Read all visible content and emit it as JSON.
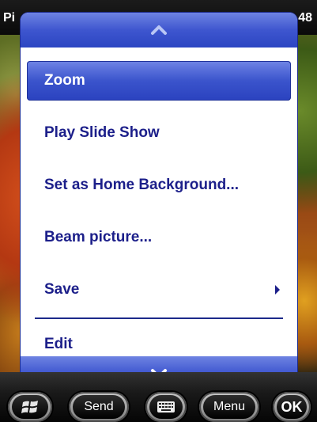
{
  "statusbar": {
    "title": "Pi",
    "clock": "48"
  },
  "menu": {
    "items": [
      {
        "label": "Zoom",
        "selected": true
      },
      {
        "label": "Play Slide Show"
      },
      {
        "label": "Set as Home Background..."
      },
      {
        "label": "Beam picture..."
      },
      {
        "label": "Save",
        "submenu": true
      },
      {
        "label": "Edit"
      }
    ],
    "scroll_up_icon": "chevron-up-icon",
    "scroll_down_icon": "chevron-down-icon"
  },
  "softkeys": {
    "start_icon": "windows-logo-icon",
    "send_label": "Send",
    "keyboard_icon": "keyboard-icon",
    "menu_label": "Menu",
    "ok_label": "OK"
  },
  "colors": {
    "menu_text": "#1c1f8a",
    "selection": "#3b54cc"
  }
}
